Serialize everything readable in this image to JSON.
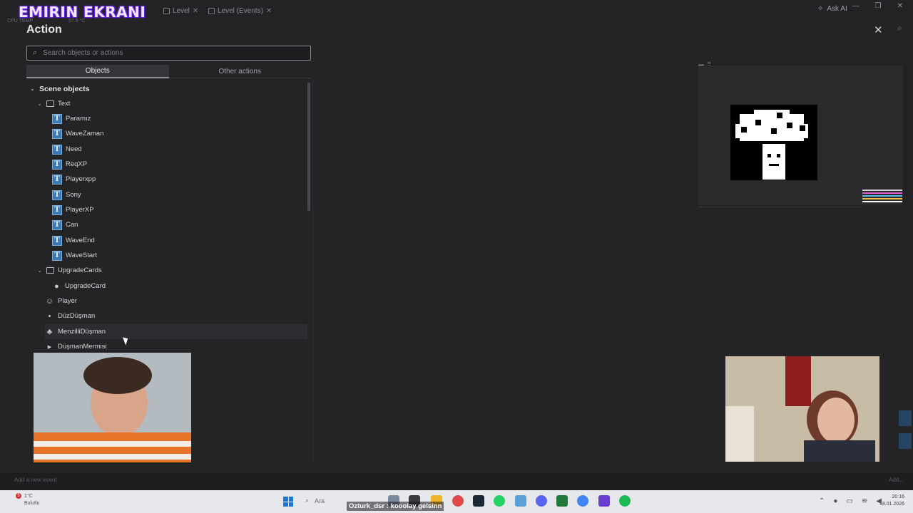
{
  "stream": {
    "overlay_title": "EMIRIN EKRANI",
    "cpu_label": "CPU TEMP",
    "cpu_value": "57.9 °C"
  },
  "topbar": {
    "tabs": [
      {
        "label": "Level"
      },
      {
        "label": "Level (Events)"
      }
    ],
    "ask_ai": "Ask AI"
  },
  "modal": {
    "title": "Action",
    "search_placeholder": "Search objects or actions",
    "tabs": {
      "objects": "Objects",
      "other": "Other actions"
    },
    "tree": {
      "root": "Scene objects",
      "text_folder": "Text",
      "text_items": [
        "Paramız",
        "WaveZaman",
        "Need",
        "ReqXP",
        "Playerxpp",
        "Sony",
        "PlayerXP",
        "Can",
        "WaveEnd",
        "WaveStart"
      ],
      "upgrade_folder": "UpgradeCards",
      "upgrade_items": [
        "UpgradeCard"
      ],
      "objects": [
        "Player",
        "DüzDüşman",
        "MenzilliDüşman",
        "DüşmanMermisi"
      ]
    }
  },
  "footer": {
    "add_event": "Add a new event",
    "add_right": "Add..."
  },
  "taskbar": {
    "weather_temp": "1°C",
    "weather_desc": "Bulutlu",
    "weather_badge": "5",
    "search_label": "Ara",
    "chat_message": "Ozturk_dsr : kooolay gelsinn",
    "time": "20:16",
    "date": "18.01.2026"
  },
  "colors": {
    "modal_bg": "#242427",
    "text_object_icon": "#3d7ab5",
    "overlay_title": "#efe6ff"
  }
}
